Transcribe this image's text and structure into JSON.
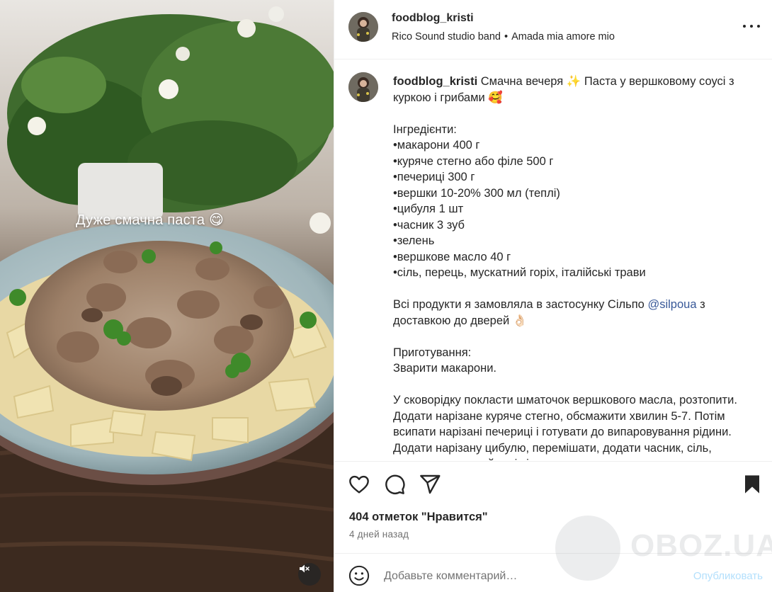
{
  "post": {
    "author": "foodblog_kristi",
    "audio_artist": "Rico Sound studio band",
    "audio_separator": "•",
    "audio_track": "Amada mia amore mio",
    "media_overlay_text": "Дуже смачна паста 😋"
  },
  "caption": {
    "author": "foodblog_kristi",
    "intro": "Смачна вечеря ✨ Паста у вершковому соусі з куркою і грибами 🥰",
    "ingredients_title": "Інгредієнти:",
    "ingredients": [
      "•макарони 400 г",
      "•куряче стегно або філе 500 г",
      "•печериці 300 г",
      "•вершки 10-20% 300 мл (теплі)",
      "•цибуля 1 шт",
      "•часник 3 зуб",
      "•зелень",
      "•вершкове масло 40 г",
      "•сіль, перець, мускатний горіх, італійські трави"
    ],
    "delivery_text": "Всі продукти я замовляла в застосунку Сільпо",
    "delivery_mention": "@silpoua",
    "delivery_text_end": "з доставкою до дверей 👌🏻",
    "prep_title": "Приготування:",
    "prep_step1": "Зварити макарони.",
    "prep_step2": "У сковорідку покласти шматочок вершкового масла, розтопити. Додати нарізане куряче стегно, обсмажити хвилин 5-7. Потім всипати нарізані печериці і готувати до випаровування рідини. Додати нарізану цибулю, перемішати, додати часник, сіль, перець, мускатний горіх і трави."
  },
  "stats": {
    "likes": "404 отметок \"Нравится\"",
    "time": "4 дней назад"
  },
  "comment": {
    "placeholder": "Добавьте комментарий…",
    "post_label": "Опубликовать"
  },
  "watermark": {
    "text": "OBOZ.UA"
  },
  "icons": {
    "like": "heart-icon",
    "comment": "comment-icon",
    "share": "share-icon",
    "save": "bookmark-icon",
    "more": "more-icon",
    "emoji": "emoji-icon",
    "mute": "mute-icon"
  },
  "colors": {
    "link": "#385898",
    "muted_text": "#737373",
    "post_button": "#b2dffc"
  }
}
